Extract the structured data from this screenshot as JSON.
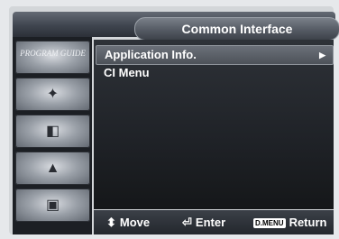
{
  "menu": {
    "title": "Common Interface",
    "items": [
      {
        "label": "Application Info.",
        "selected": true,
        "has_submenu": true
      },
      {
        "label": "CI Menu",
        "selected": false,
        "has_submenu": false
      }
    ]
  },
  "sidebar": {
    "items": [
      {
        "icon": "program-guide-icon",
        "caption": "PROGRAM GUIDE"
      },
      {
        "icon": "channel-icon"
      },
      {
        "icon": "setup-icon"
      },
      {
        "icon": "sound-icon"
      },
      {
        "icon": "interface-icon"
      }
    ]
  },
  "footer": {
    "move_label": "Move",
    "enter_label": "Enter",
    "menu_key": "D.MENU",
    "return_label": "Return"
  }
}
